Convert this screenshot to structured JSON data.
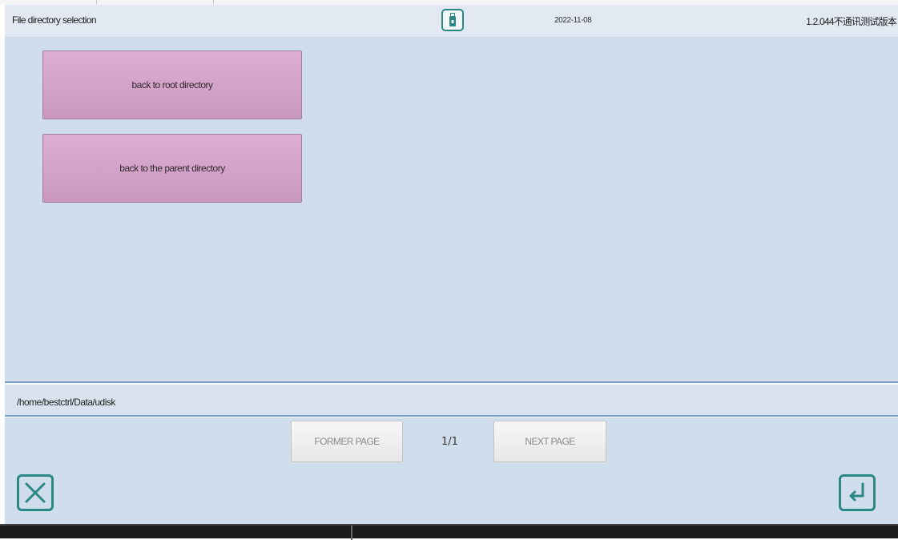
{
  "header": {
    "title": "File directory selection",
    "date": "2022-11-08",
    "version": "1.2.044不通讯测试版本",
    "status_icon": "usb-drive-icon"
  },
  "directory_buttons": [
    {
      "label": "back to root directory"
    },
    {
      "label": "back to the parent directory"
    }
  ],
  "path_bar": {
    "current_path": "/home/bestctrl/Data/udisk"
  },
  "pagination": {
    "former_label": "FORMER PAGE",
    "next_label": "NEXT PAGE",
    "page_indicator": "1/1"
  },
  "actions": {
    "cancel_icon": "close-x-icon",
    "confirm_icon": "enter-return-icon"
  },
  "colors": {
    "accent": "#2b8783",
    "directory_button": "#d4a6ca",
    "background": "#d0dded"
  }
}
